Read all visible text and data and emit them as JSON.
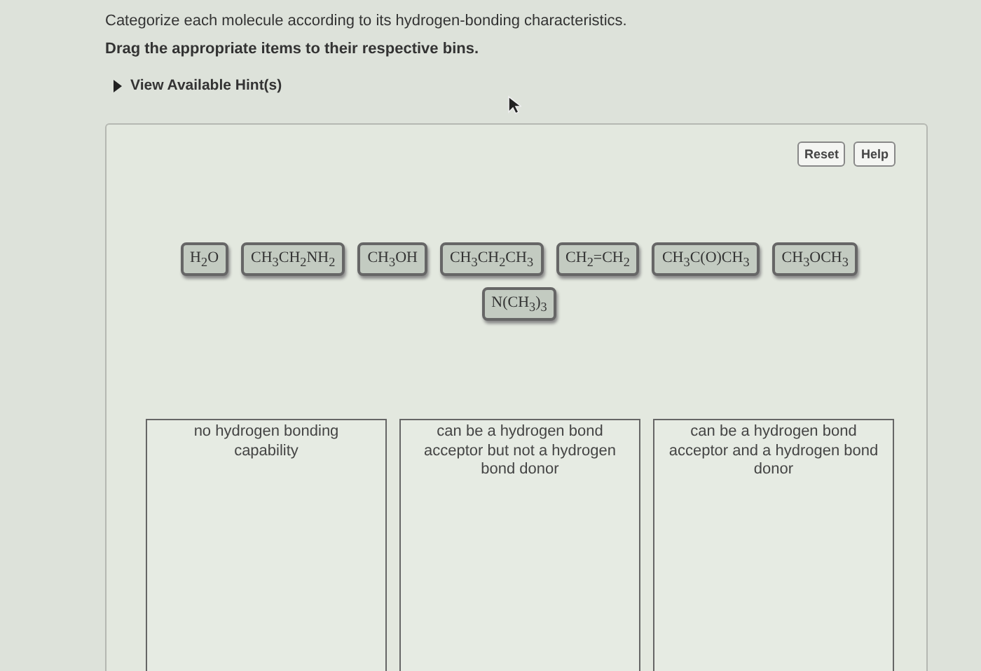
{
  "instructions": [
    "Categorize each molecule according to its hydrogen-bonding characteristics.",
    "Drag the appropriate items to their respective bins."
  ],
  "hint": {
    "label": "View Available Hint(s)",
    "expanded": false
  },
  "toolbar": [
    "Reset",
    "Help"
  ],
  "items": [
    {
      "label": "H$_{2}$O"
    },
    {
      "label": "CH$_{3}$CH$_{2}$NH$_{2}$"
    },
    {
      "label": "CH$_{3}$OH"
    },
    {
      "label": "CH$_{3}$CH$_{2}$CH$_{3}$"
    },
    {
      "label": "CH$_{2}$=CH$_{2}$"
    },
    {
      "label": "CH$_{3}$C(O)CH$_{3}$"
    },
    {
      "label": "CH$_{3}$OCH$_{3}$"
    },
    {
      "label": "N(CH$_{3}$)$_{3}$"
    }
  ],
  "bins": [
    {
      "label": "no hydrogen bonding capability"
    },
    {
      "label": "can be a hydrogen bond acceptor but not a hydrogen bond donor"
    },
    {
      "label": "can be a hydrogen bond acceptor and a hydrogen bond donor"
    }
  ]
}
